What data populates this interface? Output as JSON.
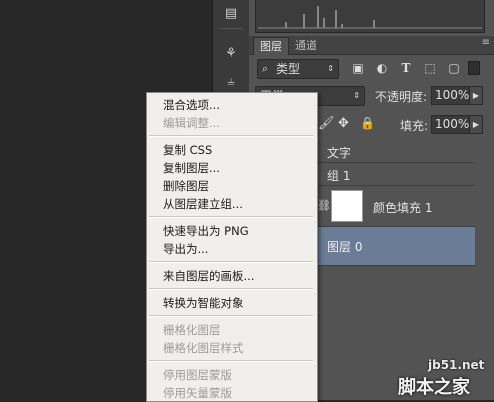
{
  "layers_panel": {
    "tabs": [
      {
        "label": "图层",
        "active": true
      },
      {
        "label": "通道",
        "active": false
      }
    ],
    "panel_menu_icon": "≡",
    "filter": {
      "value": "类型",
      "icon": "search-icon"
    },
    "blend_mode": {
      "value": "正常"
    },
    "opacity": {
      "label": "不透明度:",
      "value": "100%"
    },
    "fill": {
      "label": "填充:",
      "value": "100%"
    },
    "layers": [
      {
        "name": "文字",
        "type": "text",
        "selected": false
      },
      {
        "name": "组 1",
        "type": "group",
        "selected": false
      },
      {
        "name": "颜色填充 1",
        "type": "fill",
        "selected": false
      },
      {
        "name": "图层 0",
        "type": "layer",
        "selected": true
      }
    ]
  },
  "context_menu": {
    "items": [
      {
        "label": "混合选项...",
        "enabled": true
      },
      {
        "label": "编辑调整...",
        "enabled": false
      },
      {
        "label": "复制 CSS",
        "enabled": true
      },
      {
        "label": "复制图层...",
        "enabled": true
      },
      {
        "label": "删除图层",
        "enabled": true
      },
      {
        "label": "从图层建立组...",
        "enabled": true
      },
      {
        "label": "快速导出为 PNG",
        "enabled": true
      },
      {
        "label": "导出为...",
        "enabled": true
      },
      {
        "label": "来自图层的画板...",
        "enabled": true
      },
      {
        "label": "转换为智能对象",
        "enabled": true
      },
      {
        "label": "栅格化图层",
        "enabled": false
      },
      {
        "label": "栅格化图层样式",
        "enabled": false
      },
      {
        "label": "停用图层蒙版",
        "enabled": false
      },
      {
        "label": "停用矢量蒙版",
        "enabled": false
      }
    ]
  },
  "watermark": {
    "line1": "jb51.net",
    "line2": "脚本之家"
  },
  "colors": {
    "canvas": "#282828",
    "panel": "#535353",
    "selection": "#6b7d96",
    "menu_bg": "#f0efec"
  }
}
